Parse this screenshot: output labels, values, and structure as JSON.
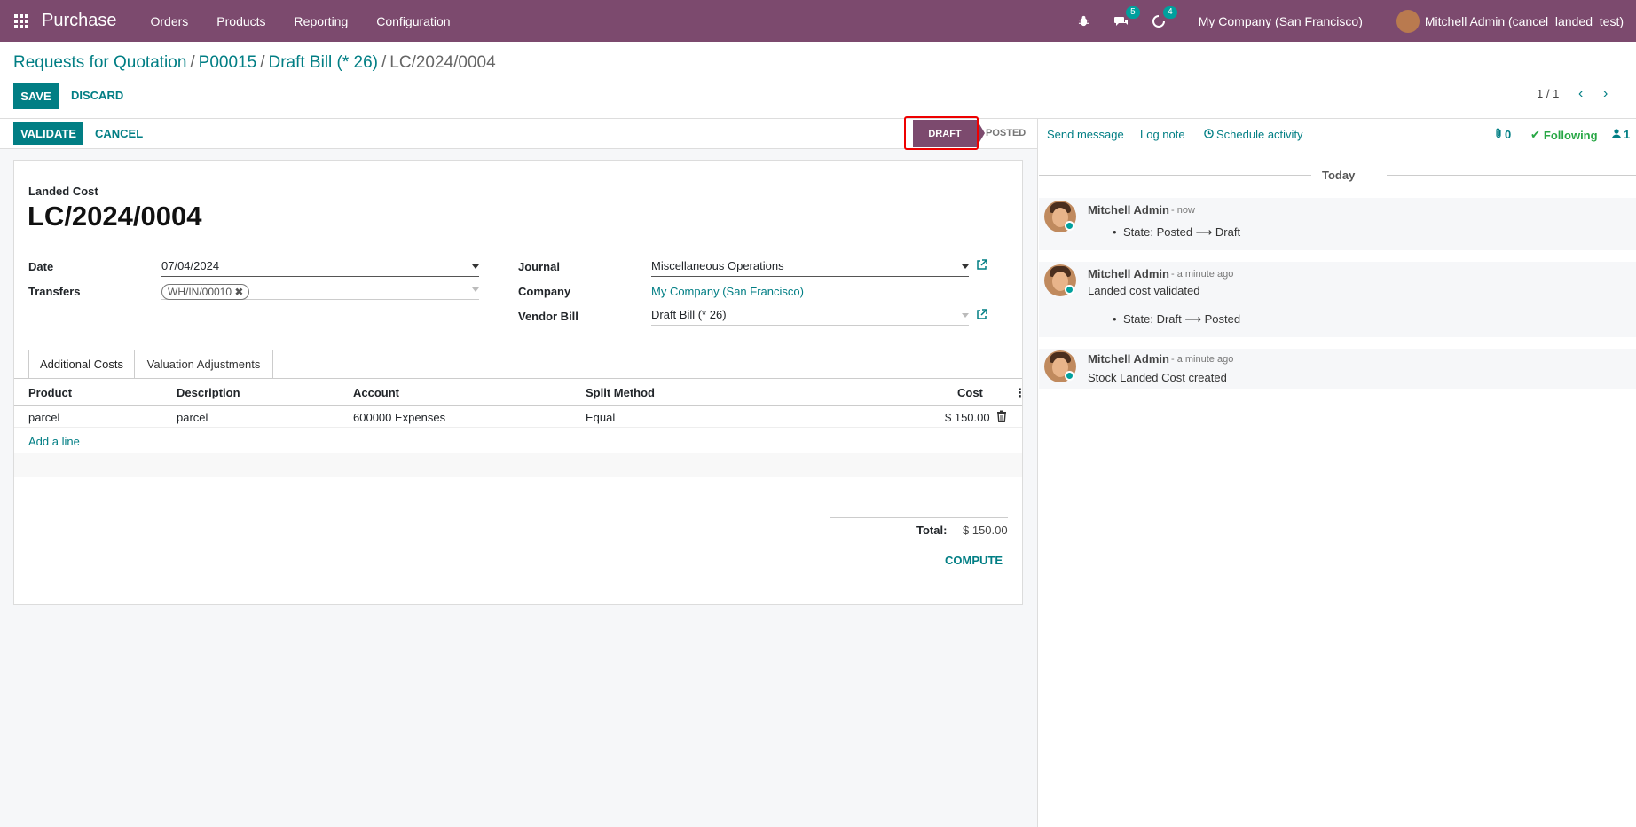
{
  "nav": {
    "app_name": "Purchase",
    "menu": [
      "Orders",
      "Products",
      "Reporting",
      "Configuration"
    ],
    "messages_count": "5",
    "activities_count": "4",
    "company": "My Company (San Francisco)",
    "user": "Mitchell Admin (cancel_landed_test)"
  },
  "breadcrumb": {
    "items": [
      "Requests for Quotation",
      "P00015",
      "Draft Bill (* 26)"
    ],
    "current": "LC/2024/0004",
    "sep": "/"
  },
  "buttons": {
    "save": "SAVE",
    "discard": "DISCARD",
    "validate": "VALIDATE",
    "cancel": "CANCEL",
    "compute": "COMPUTE"
  },
  "pager": {
    "value": "1 / 1",
    "prev": "‹",
    "next": "›"
  },
  "status": {
    "draft": "DRAFT",
    "posted": "POSTED"
  },
  "form": {
    "title_label": "Landed Cost",
    "title": "LC/2024/0004",
    "date_label": "Date",
    "date": "07/04/2024",
    "transfers_label": "Transfers",
    "transfer_tag": "WH/IN/00010",
    "journal_label": "Journal",
    "journal": "Miscellaneous Operations",
    "company_label": "Company",
    "company": "My Company (San Francisco)",
    "vendor_bill_label": "Vendor Bill",
    "vendor_bill": "Draft Bill (* 26)"
  },
  "tabs": [
    "Additional Costs",
    "Valuation Adjustments"
  ],
  "table": {
    "headers": [
      "Product",
      "Description",
      "Account",
      "Split Method",
      "Cost"
    ],
    "rows": [
      [
        "parcel",
        "parcel",
        "600000 Expenses",
        "Equal",
        "$ 150.00"
      ]
    ],
    "add_line": "Add a line",
    "total_label": "Total:",
    "total_value": "$ 150.00"
  },
  "chatter": {
    "send_message": "Send message",
    "log_note": "Log note",
    "schedule_activity": "Schedule activity",
    "attachments": "0",
    "following": "Following",
    "followers": "1",
    "date_separator": "Today",
    "messages": [
      {
        "author": "Mitchell Admin",
        "time": "- now",
        "text": "",
        "bullet": "State: Posted ⟶ Draft"
      },
      {
        "author": "Mitchell Admin",
        "time": "- a minute ago",
        "text": "Landed cost validated",
        "bullet": "State: Draft ⟶ Posted"
      },
      {
        "author": "Mitchell Admin",
        "time": "- a minute ago",
        "text": "Stock Landed Cost created",
        "bullet": ""
      }
    ]
  },
  "colors": {
    "brand": "#7c4a6e",
    "accent": "#017e84",
    "highlight": "#e00000"
  }
}
